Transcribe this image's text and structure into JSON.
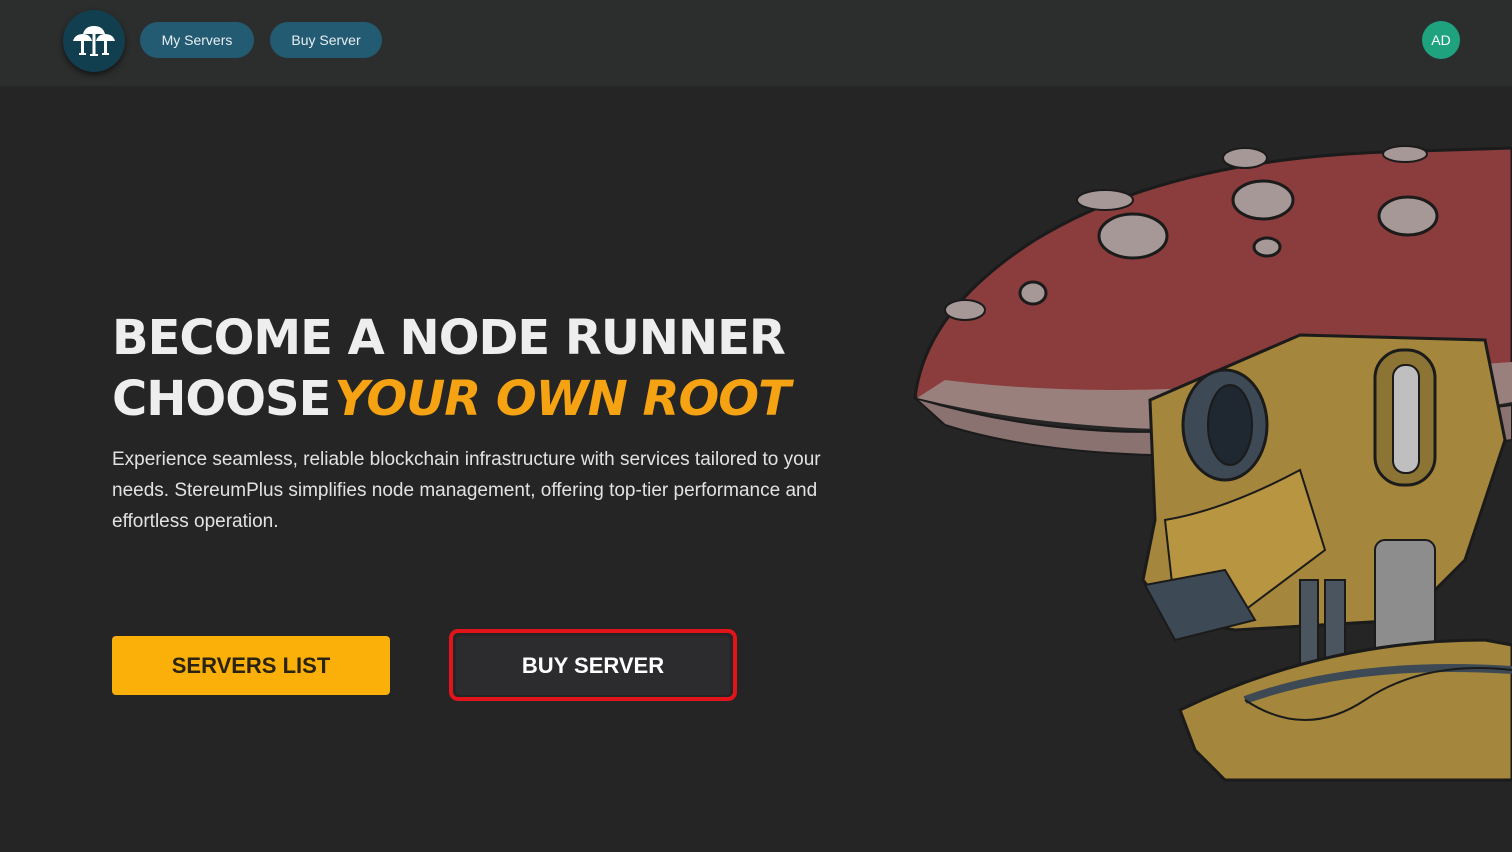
{
  "header": {
    "logo_icon": "mushroom-logo-icon",
    "nav": {
      "my_servers": "My Servers",
      "buy_server": "Buy Server"
    },
    "avatar_initials": "AD"
  },
  "hero": {
    "title_line1": "BECOME A NODE RUNNER",
    "title_line2_prefix": "CHOOSE",
    "title_line2_accent": "YOUR OWN ROOT",
    "description": "Experience seamless, reliable blockchain infrastructure with services tailored to your needs. StereumPlus simplifies node management, offering top-tier performance and effortless operation.",
    "buttons": {
      "servers_list": "SERVERS LIST",
      "buy_server": "BUY SERVER"
    }
  },
  "colors": {
    "background": "#252525",
    "topbar": "#2c2d2d",
    "nav_pill": "#235b73",
    "accent": "#f6a313",
    "primary_button": "#fbb009",
    "avatar": "#1fa37f",
    "highlight": "#e0141a"
  }
}
